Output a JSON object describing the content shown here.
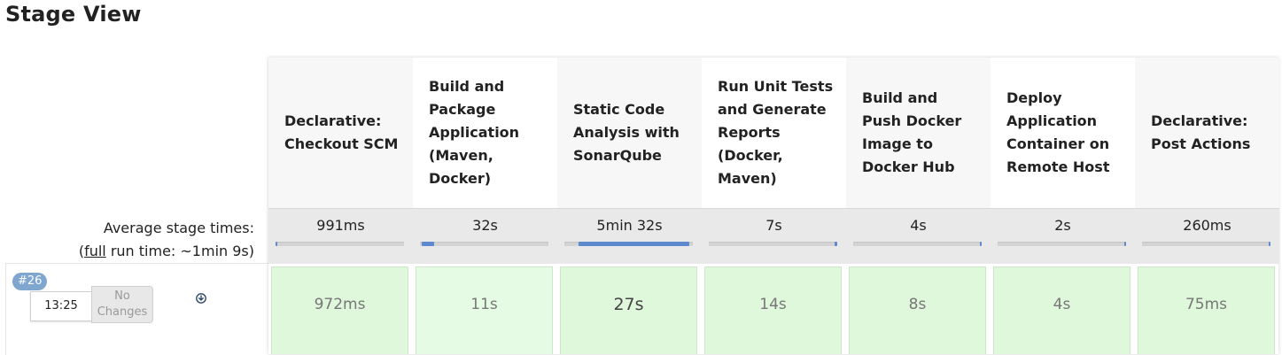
{
  "page": {
    "title": "Stage View"
  },
  "summary": {
    "avg_label": "Average stage times:",
    "full_run_prefix": "(",
    "full_link": "full",
    "full_run_suffix": " run time: ~1min 9s)"
  },
  "colors": {
    "cell_bg": "#dff7da",
    "cell_bg_alt": "#e6fbe3",
    "progress_fill": "#5f89cf",
    "badge_bg": "#7ea6cf"
  },
  "stages": [
    {
      "name": "Declarative: Checkout SCM",
      "avg": "991ms",
      "avg_fraction": 0.003,
      "run": "972ms"
    },
    {
      "name": "Build and Package Application (Maven, Docker)",
      "avg": "32s",
      "avg_fraction": 0.097,
      "run": "11s"
    },
    {
      "name": "Static Code Analysis with SonarQube",
      "avg": "5min 32s",
      "avg_fraction": 0.86,
      "run": "27s"
    },
    {
      "name": "Run Unit Tests and Generate Reports (Docker, Maven)",
      "avg": "7s",
      "avg_fraction": 0.021,
      "run": "14s"
    },
    {
      "name": "Build and Push Docker Image to Docker Hub",
      "avg": "4s",
      "avg_fraction": 0.012,
      "run": "8s"
    },
    {
      "name": "Deploy Application Container on Remote Host",
      "avg": "2s",
      "avg_fraction": 0.006,
      "run": "4s"
    },
    {
      "name": "Declarative: Post Actions",
      "avg": "260ms",
      "avg_fraction": 0.001,
      "run": "75ms"
    }
  ],
  "runs": [
    {
      "build": "#26",
      "time": "13:25",
      "changes_label": "No Changes",
      "icon": "download-circle-icon"
    }
  ]
}
